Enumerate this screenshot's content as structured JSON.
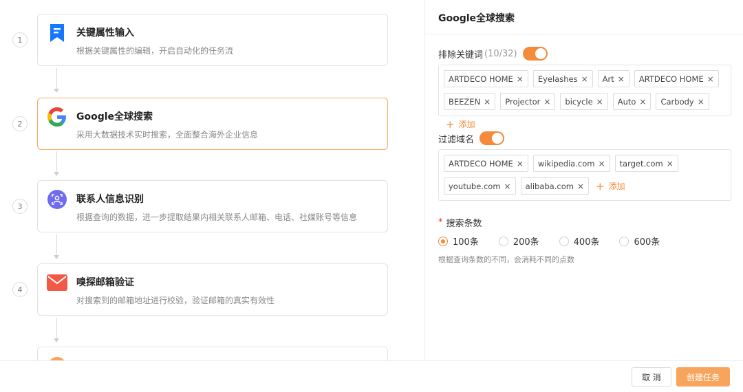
{
  "workflow": {
    "steps": [
      {
        "num": "1",
        "title": "关键属性输入",
        "desc": "根据关键属性的编辑，开启自动化的任务流",
        "icon": "bookmark-icon",
        "color": "#1677ff"
      },
      {
        "num": "2",
        "title": "Google全球搜索",
        "desc": "采用大数据技术实时搜索，全面整合海外企业信息",
        "icon": "google-icon",
        "active": true
      },
      {
        "num": "3",
        "title": "联系人信息识别",
        "desc": "根据查询的数据，进一步提取结果内相关联系人邮箱、电话、社媒账号等信息",
        "icon": "contact-scan-icon",
        "color": "#6f6cf0"
      },
      {
        "num": "4",
        "title": "嗅探邮箱验证",
        "desc": "对搜索到的邮箱地址进行校验，验证邮箱的真实有效性",
        "icon": "mail-icon",
        "color": "#f25a47"
      },
      {
        "num": "",
        "title": "",
        "desc": "",
        "icon": "partial-step-icon",
        "color": "#f7a45c"
      }
    ]
  },
  "panel": {
    "title": "Google全球搜索",
    "exclude": {
      "label": "排除关键词",
      "count": "(10/32)",
      "enabled": true,
      "tags": [
        "ARTDECO HOME",
        "Eyelashes",
        "Art",
        "ARTDECO HOME",
        "BEEZEN",
        "Projector",
        "bicycle",
        "Auto",
        "Carbody"
      ],
      "add_label": "添加"
    },
    "domains": {
      "label": "过滤域名",
      "enabled": true,
      "tags": [
        "ARTDECO HOME",
        "wikipedia.com",
        "target.com",
        "youtube.com",
        "alibaba.com"
      ],
      "add_label": "添加"
    },
    "count": {
      "label": "搜索条数",
      "options": [
        "100条",
        "200条",
        "400条",
        "600条"
      ],
      "selected": "100条",
      "hint": "根据查询条数的不同，会消耗不同的点数"
    }
  },
  "footer": {
    "cancel_label": "取 消",
    "create_label": "创建任务"
  },
  "colors": {
    "accent": "#f48a3a",
    "active_border": "#f7a964",
    "primary_button": "#f7a45c"
  }
}
